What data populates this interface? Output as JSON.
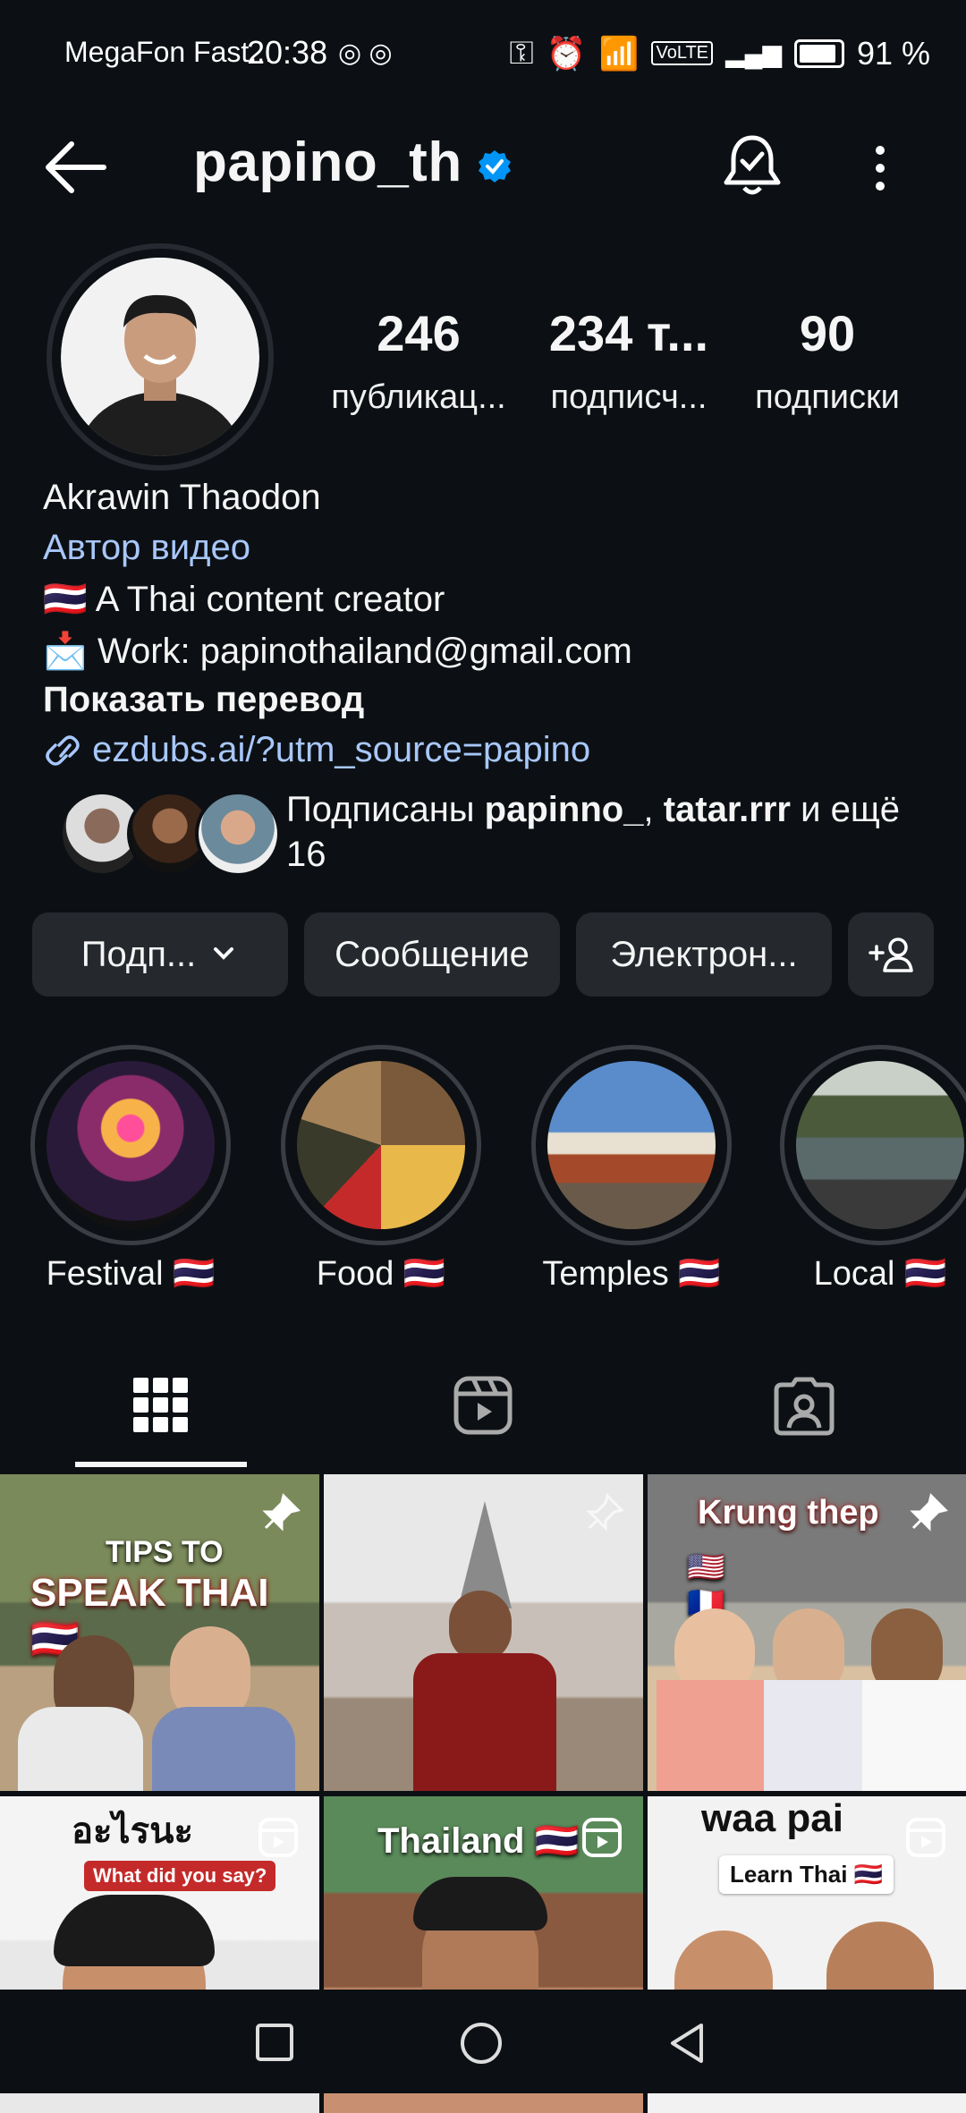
{
  "status_bar": {
    "carrier": "MegaFon Fast...",
    "time": "20:38",
    "battery": "91 %",
    "network": "VoLTE"
  },
  "header": {
    "username": "papino_th"
  },
  "stats": [
    {
      "value": "246",
      "label": "публикац..."
    },
    {
      "value": "234 т...",
      "label": "подписч..."
    },
    {
      "value": "90",
      "label": "подписки"
    }
  ],
  "bio": {
    "name": "Akrawin Thaodon",
    "category": "Автор видео",
    "line1_flag": "🇹🇭",
    "line1": "A Thai content creator",
    "line2_icon": "📩",
    "line2": "Work: papinothailand@gmail.com",
    "translate": "Показать перевод",
    "link": "ezdubs.ai/?utm_source=papino"
  },
  "mutuals": {
    "prefix": "Подписаны ",
    "user1": "papinno_",
    "sep": ", ",
    "user2": "tatar.rrr",
    "suffix": " и ещё 16"
  },
  "buttons": {
    "follow": "Подп...",
    "message": "Сообщение",
    "email": "Электрон..."
  },
  "highlights": [
    {
      "label": "Festival 🇹🇭"
    },
    {
      "label": "Food 🇹🇭"
    },
    {
      "label": "Temples 🇹🇭"
    },
    {
      "label": "Local 🇹🇭"
    }
  ],
  "posts": {
    "p1_line1": "TIPS TO",
    "p1_line2": "SPEAK THAI 🇹🇭",
    "p3_caption": "Krung thep",
    "p3_flags": "🇺🇸 🇫🇷 🇹🇭",
    "p4_top": "อะไรนะ",
    "p4_sub": "What did you say?",
    "p5_caption": "Thailand 🇹🇭",
    "p6_top": "waa pai",
    "p6_sub": "Learn Thai 🇹🇭"
  },
  "colors": {
    "background": "#0c1014",
    "button": "#25292e",
    "link": "#a8c7fa",
    "verified": "#0095f6"
  }
}
